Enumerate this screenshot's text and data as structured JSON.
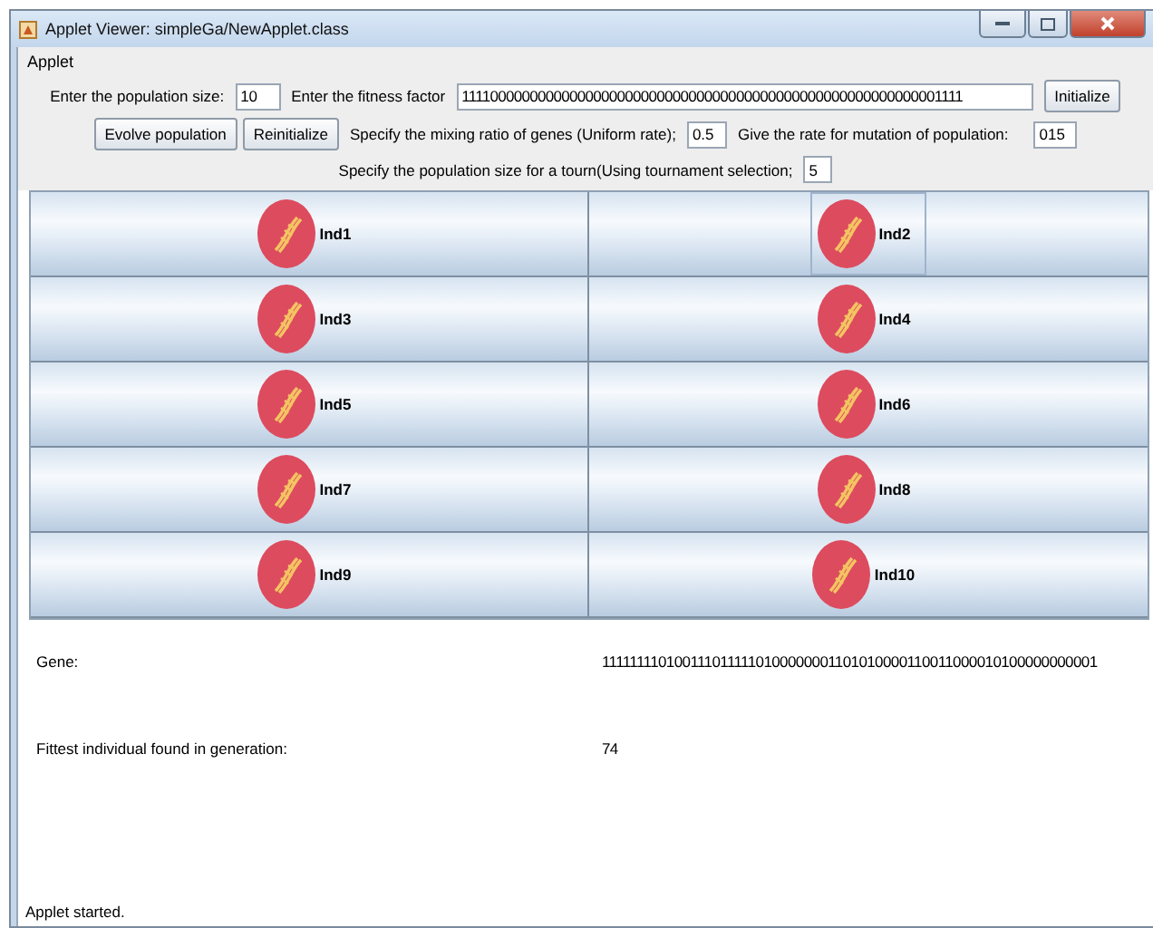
{
  "window": {
    "title": "Applet Viewer: simpleGa/NewApplet.class"
  },
  "menu": [
    "Applet"
  ],
  "controls": {
    "population_label": "Enter the population size:",
    "population_value": "10",
    "fitness_label": "Enter the fitness factor",
    "fitness_value": "1111000000000000000000000000000000000000000000000000000000001111",
    "initialize_button": "Initialize",
    "evolve_button": "Evolve population",
    "reinitialize_button": "Reinitialize",
    "mixing_label": "Specify the mixing ratio of genes (Uniform rate);",
    "mixing_value": "0.5",
    "mutation_label": "Give the rate for mutation of population:",
    "mutation_value": "015",
    "tournament_label": "Specify the population size for a tourn(Using tournament selection;",
    "tournament_value": "5"
  },
  "individuals": [
    {
      "label": "Ind1",
      "selected": false
    },
    {
      "label": "Ind2",
      "selected": true
    },
    {
      "label": "Ind3",
      "selected": false
    },
    {
      "label": "Ind4",
      "selected": false
    },
    {
      "label": "Ind5",
      "selected": false
    },
    {
      "label": "Ind6",
      "selected": false
    },
    {
      "label": "Ind7",
      "selected": false
    },
    {
      "label": "Ind8",
      "selected": false
    },
    {
      "label": "Ind9",
      "selected": false
    },
    {
      "label": "Ind10",
      "selected": false
    }
  ],
  "results": [
    {
      "label": "Gene:",
      "value": "1111111101001110111110100000001101010000110011000010100000000001"
    },
    {
      "label": "Fittest individual found in generation:",
      "value": "74"
    }
  ],
  "status_bar": "Applet started."
}
